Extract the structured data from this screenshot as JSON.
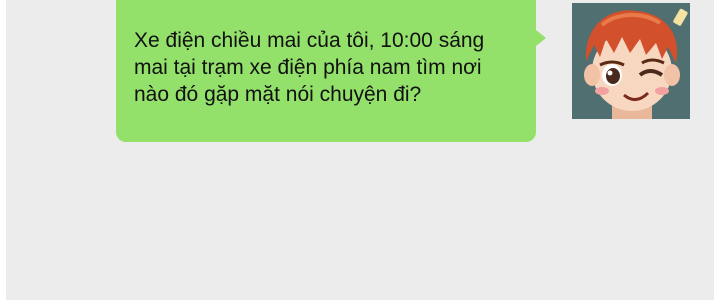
{
  "chat": {
    "message": {
      "text": "Xe điện chiều mai của tôi, 10:00 sáng mai tại trạm xe điện phía nam tìm nơi nào đó gặp mặt nói chuyện đi?",
      "bubble_color": "#93e06a",
      "direction": "outgoing"
    },
    "avatar": {
      "icon": "winking-boy-avatar-icon"
    },
    "background_color": "#ececec"
  }
}
